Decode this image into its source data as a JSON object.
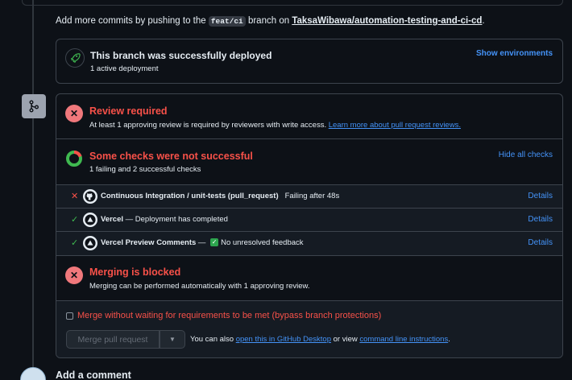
{
  "hint": {
    "prefix": "Add more commits by pushing to the ",
    "branch": "feat/ci",
    "middle": " branch on ",
    "repo": "TaksaWibawa/automation-testing-and-ci-cd",
    "suffix": "."
  },
  "deployment": {
    "title": "This branch was successfully deployed",
    "subtitle": "1 active deployment",
    "show_environments": "Show environments"
  },
  "review": {
    "title": "Review required",
    "description": "At least 1 approving review is required by reviewers with write access.",
    "learn_more": "Learn more about pull request reviews."
  },
  "checks": {
    "title": "Some checks were not successful",
    "subtitle": "1 failing and 2 successful checks",
    "hide_all": "Hide all checks",
    "rows": [
      {
        "status": "✕",
        "name": "Continuous Integration / unit-tests (pull_request)",
        "detail": "Failing after 48s",
        "details_label": "Details"
      },
      {
        "status": "✓",
        "name": "Vercel",
        "detail": " — Deployment has completed",
        "details_label": "Details"
      },
      {
        "status": "✓",
        "name": "Vercel Preview Comments",
        "detail_prefix": " — ",
        "detail": "No unresolved feedback",
        "details_label": "Details"
      }
    ]
  },
  "blocked": {
    "title": "Merging is blocked",
    "subtitle": "Merging can be performed automatically with 1 approving review."
  },
  "actions": {
    "bypass_label": "Merge without waiting for requirements to be met (bypass branch protections)",
    "merge_button": "Merge pull request",
    "also_prefix": "You can also ",
    "desktop_link": "open this in GitHub Desktop",
    "or_view": " or view ",
    "cli_link": "command line instructions",
    "also_suffix": "."
  },
  "comment": {
    "heading": "Add a comment"
  },
  "colors": {
    "failure": "#f85149",
    "success": "#3fb950",
    "link": "#4493f8",
    "background": "#0d1117"
  }
}
